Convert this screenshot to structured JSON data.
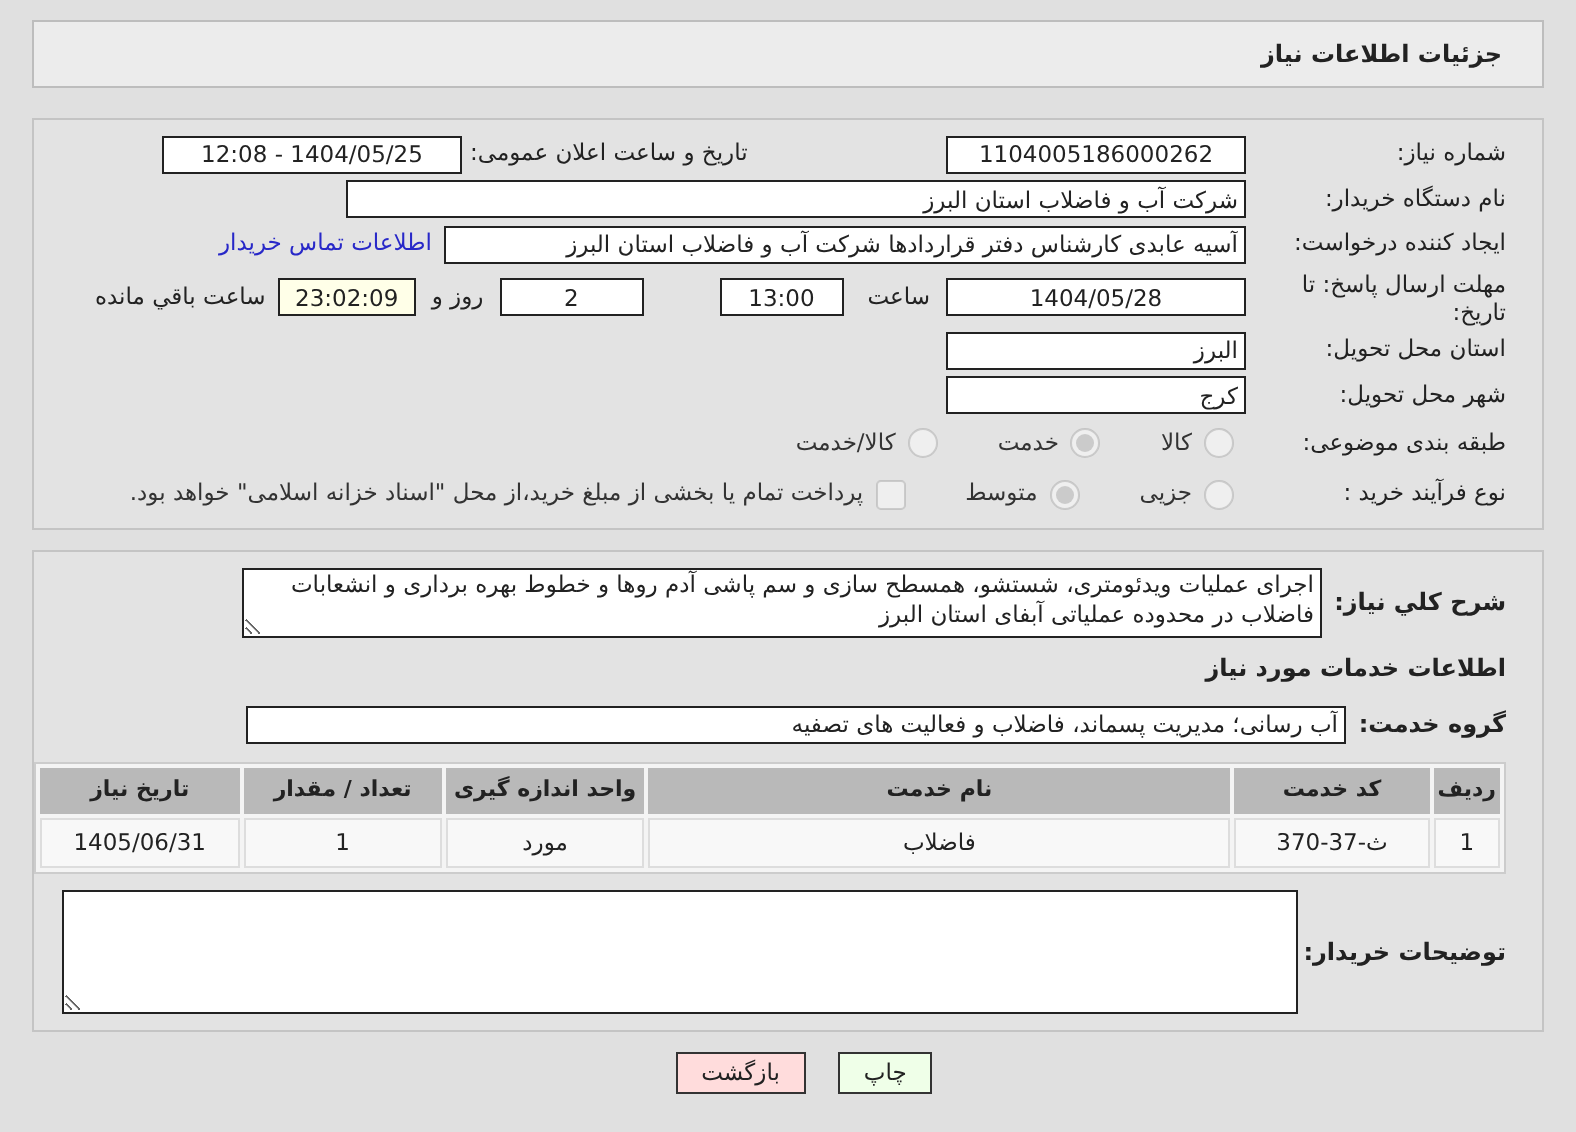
{
  "header": {
    "title": "جزئیات اطلاعات نیاز"
  },
  "need_number": {
    "label": "شماره نیاز:",
    "value": "1104005186000262"
  },
  "announce": {
    "label": "تاریخ و ساعت اعلان عمومی:",
    "value": "1404/05/25 - 12:08"
  },
  "buyer_org": {
    "label": "نام دستگاه خریدار:",
    "value": "شرکت آب و فاضلاب استان البرز"
  },
  "creator": {
    "label": "ایجاد کننده درخواست:",
    "value": "آسیه عابدی کارشناس دفتر قراردادها شرکت آب و فاضلاب استان البرز",
    "contact_link": "اطلاعات تماس خریدار"
  },
  "deadline": {
    "label": "مهلت ارسال پاسخ: تا تاریخ:",
    "date": "1404/05/28",
    "time_label": "ساعت",
    "time": "13:00",
    "days": "2",
    "days_label": "روز و",
    "remaining": "23:02:09",
    "remaining_label": "ساعت باقي مانده"
  },
  "province": {
    "label": "استان محل تحویل:",
    "value": "البرز"
  },
  "city": {
    "label": "شهر محل تحویل:",
    "value": "کرج"
  },
  "category": {
    "label": "طبقه بندی موضوعی:",
    "options": [
      {
        "label": "کالا",
        "selected": false,
        "disabled": true
      },
      {
        "label": "خدمت",
        "selected": true,
        "disabled": true
      },
      {
        "label": "کالا/خدمت",
        "selected": false,
        "disabled": true
      }
    ]
  },
  "process": {
    "label": "نوع فرآیند خرید :",
    "options": [
      {
        "label": "جزیی",
        "selected": false,
        "disabled": true
      },
      {
        "label": "متوسط",
        "selected": true,
        "disabled": true
      }
    ],
    "payment": {
      "checked": false,
      "disabled": true,
      "text": "پرداخت تمام یا بخشی از مبلغ خرید،از محل \"اسناد خزانه اسلامی\" خواهد بود."
    }
  },
  "description": {
    "label": "شرح کلي نیاز:",
    "value": "اجرای عملیات ویدئومتری، شستشو، همسطح سازی و سم پاشی آدم روها و خطوط بهره برداری و انشعابات فاضلاب در محدوده عملیاتی آبفای استان البرز"
  },
  "services_title": "اطلاعات خدمات مورد نیاز",
  "service_group": {
    "label": "گروه خدمت:",
    "value": "آب رسانی؛ مدیریت پسماند، فاضلاب و فعالیت های تصفیه"
  },
  "table": {
    "columns": [
      "ردیف",
      "کد خدمت",
      "نام خدمت",
      "واحد اندازه گیری",
      "تعداد / مقدار",
      "تاریخ نیاز"
    ],
    "rows": [
      [
        "1",
        "ث-37-370",
        "فاضلاب",
        "مورد",
        "1",
        "1405/06/31"
      ]
    ]
  },
  "buyer_notes": {
    "label": "توضیحات خریدار:"
  },
  "buttons": [
    {
      "label": "چاپ",
      "kind": "print"
    },
    {
      "label": "بازگشت",
      "kind": "back"
    }
  ]
}
